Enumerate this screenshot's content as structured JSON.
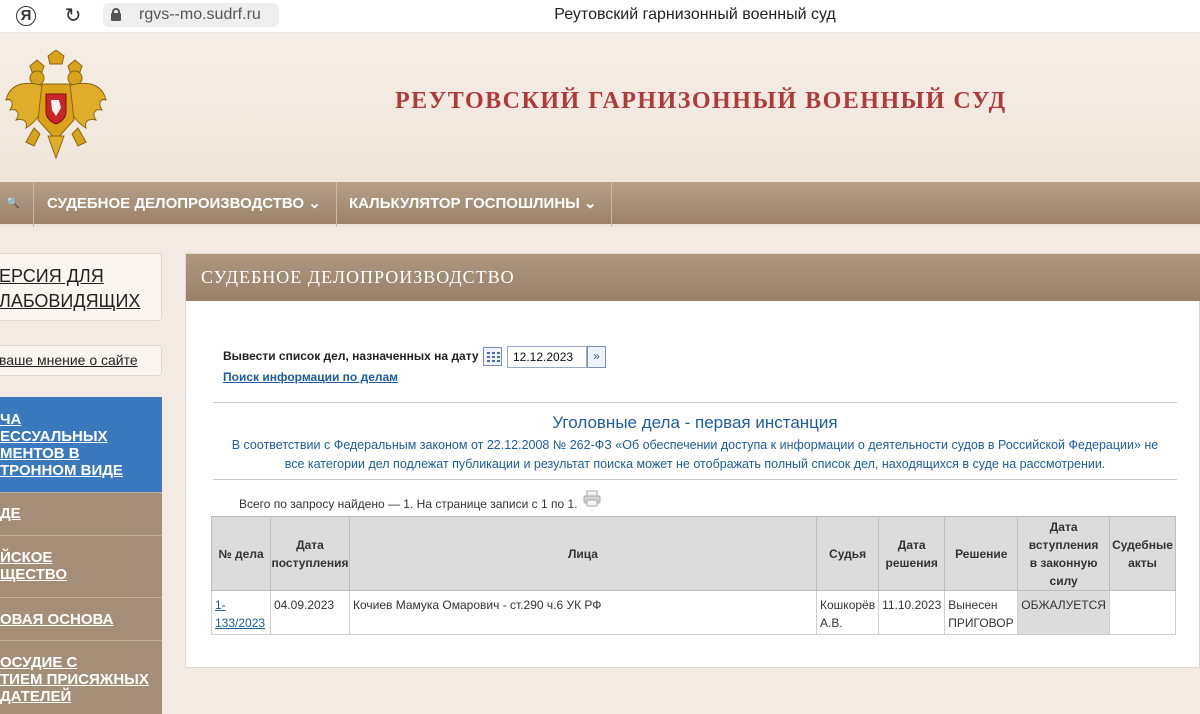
{
  "browser": {
    "ya_label": "Я",
    "url": "rgvs--mo.sudrf.ru",
    "tab_title": "Реутовский гарнизонный военный суд"
  },
  "header": {
    "site_title": "РЕУТОВСКИЙ ГАРНИЗОННЫЙ ВОЕННЫЙ СУД",
    "emblem_icon": "russian-coat-of-arms"
  },
  "top_nav": {
    "items": [
      {
        "label": "СУДЕБНОЕ ДЕЛОПРОИЗВОДСТВО ⌄"
      },
      {
        "label": "КАЛЬКУЛЯТОР ГОСПОШЛИНЫ ⌄"
      }
    ]
  },
  "sidebar": {
    "visually_impaired": [
      "ЕРСИЯ ДЛЯ",
      "ЛАБОВИДЯЩИХ"
    ],
    "opinion_link": "ваше мнение о сайте",
    "items": [
      {
        "lines": [
          "ЧА",
          "ЕССУАЛЬНЫХ",
          "МЕНТОВ В",
          "ТРОННОМ ВИДЕ"
        ]
      },
      {
        "lines": [
          "ДЕ"
        ]
      },
      {
        "lines": [
          "ЙСКОЕ",
          "ЩЕСТВО"
        ]
      },
      {
        "lines": [
          "ОВАЯ ОСНОВА"
        ]
      },
      {
        "lines": [
          "ОСУДИЕ С",
          "ТИЕМ ПРИСЯЖНЫХ",
          "ДАТЕЛЕЙ"
        ]
      }
    ]
  },
  "main": {
    "panel_title": "СУДЕБНОЕ ДЕЛОПРОИЗВОДСТВО",
    "date_label": "Вывести список дел, назначенных на дату",
    "date_value": "12.12.2023",
    "search_link": "Поиск информации по делам",
    "section_title": "Уголовные дела - первая инстанция",
    "notice_line1": "В соответствии с Федеральным законом от 22.12.2008 № 262-ФЗ «Об обеспечении доступа к информации о деятельности судов в Российской Федерации» не",
    "notice_line2": "все категории дел подлежат публикации и результат поиска может не отображать полный список дел, находящихся в суде на рассмотрении.",
    "found_text": "Всего по запросу найдено — 1. На странице записи с 1 по 1.",
    "table": {
      "headers": {
        "case_no": "№ дела",
        "received": [
          "Дата",
          "поступления"
        ],
        "persons": "Лица",
        "judge": "Судья",
        "decision_date": [
          "Дата",
          "решения"
        ],
        "decision": "Решение",
        "effective": [
          "Дата",
          "вступления",
          "в законную",
          "силу"
        ],
        "acts": [
          "Судебные",
          "акты"
        ]
      },
      "rows": [
        {
          "case_no": [
            "1-",
            "133/2023"
          ],
          "received": "04.09.2023",
          "persons": "Кочиев Мамука Омарович - ст.290 ч.6 УК РФ",
          "judge": [
            "Кошкорёв",
            "А.В."
          ],
          "decision_date": "11.10.2023",
          "decision": [
            "Вынесен",
            "ПРИГОВОР"
          ],
          "effective": "ОБЖАЛУЕТСЯ",
          "acts": ""
        }
      ]
    }
  }
}
